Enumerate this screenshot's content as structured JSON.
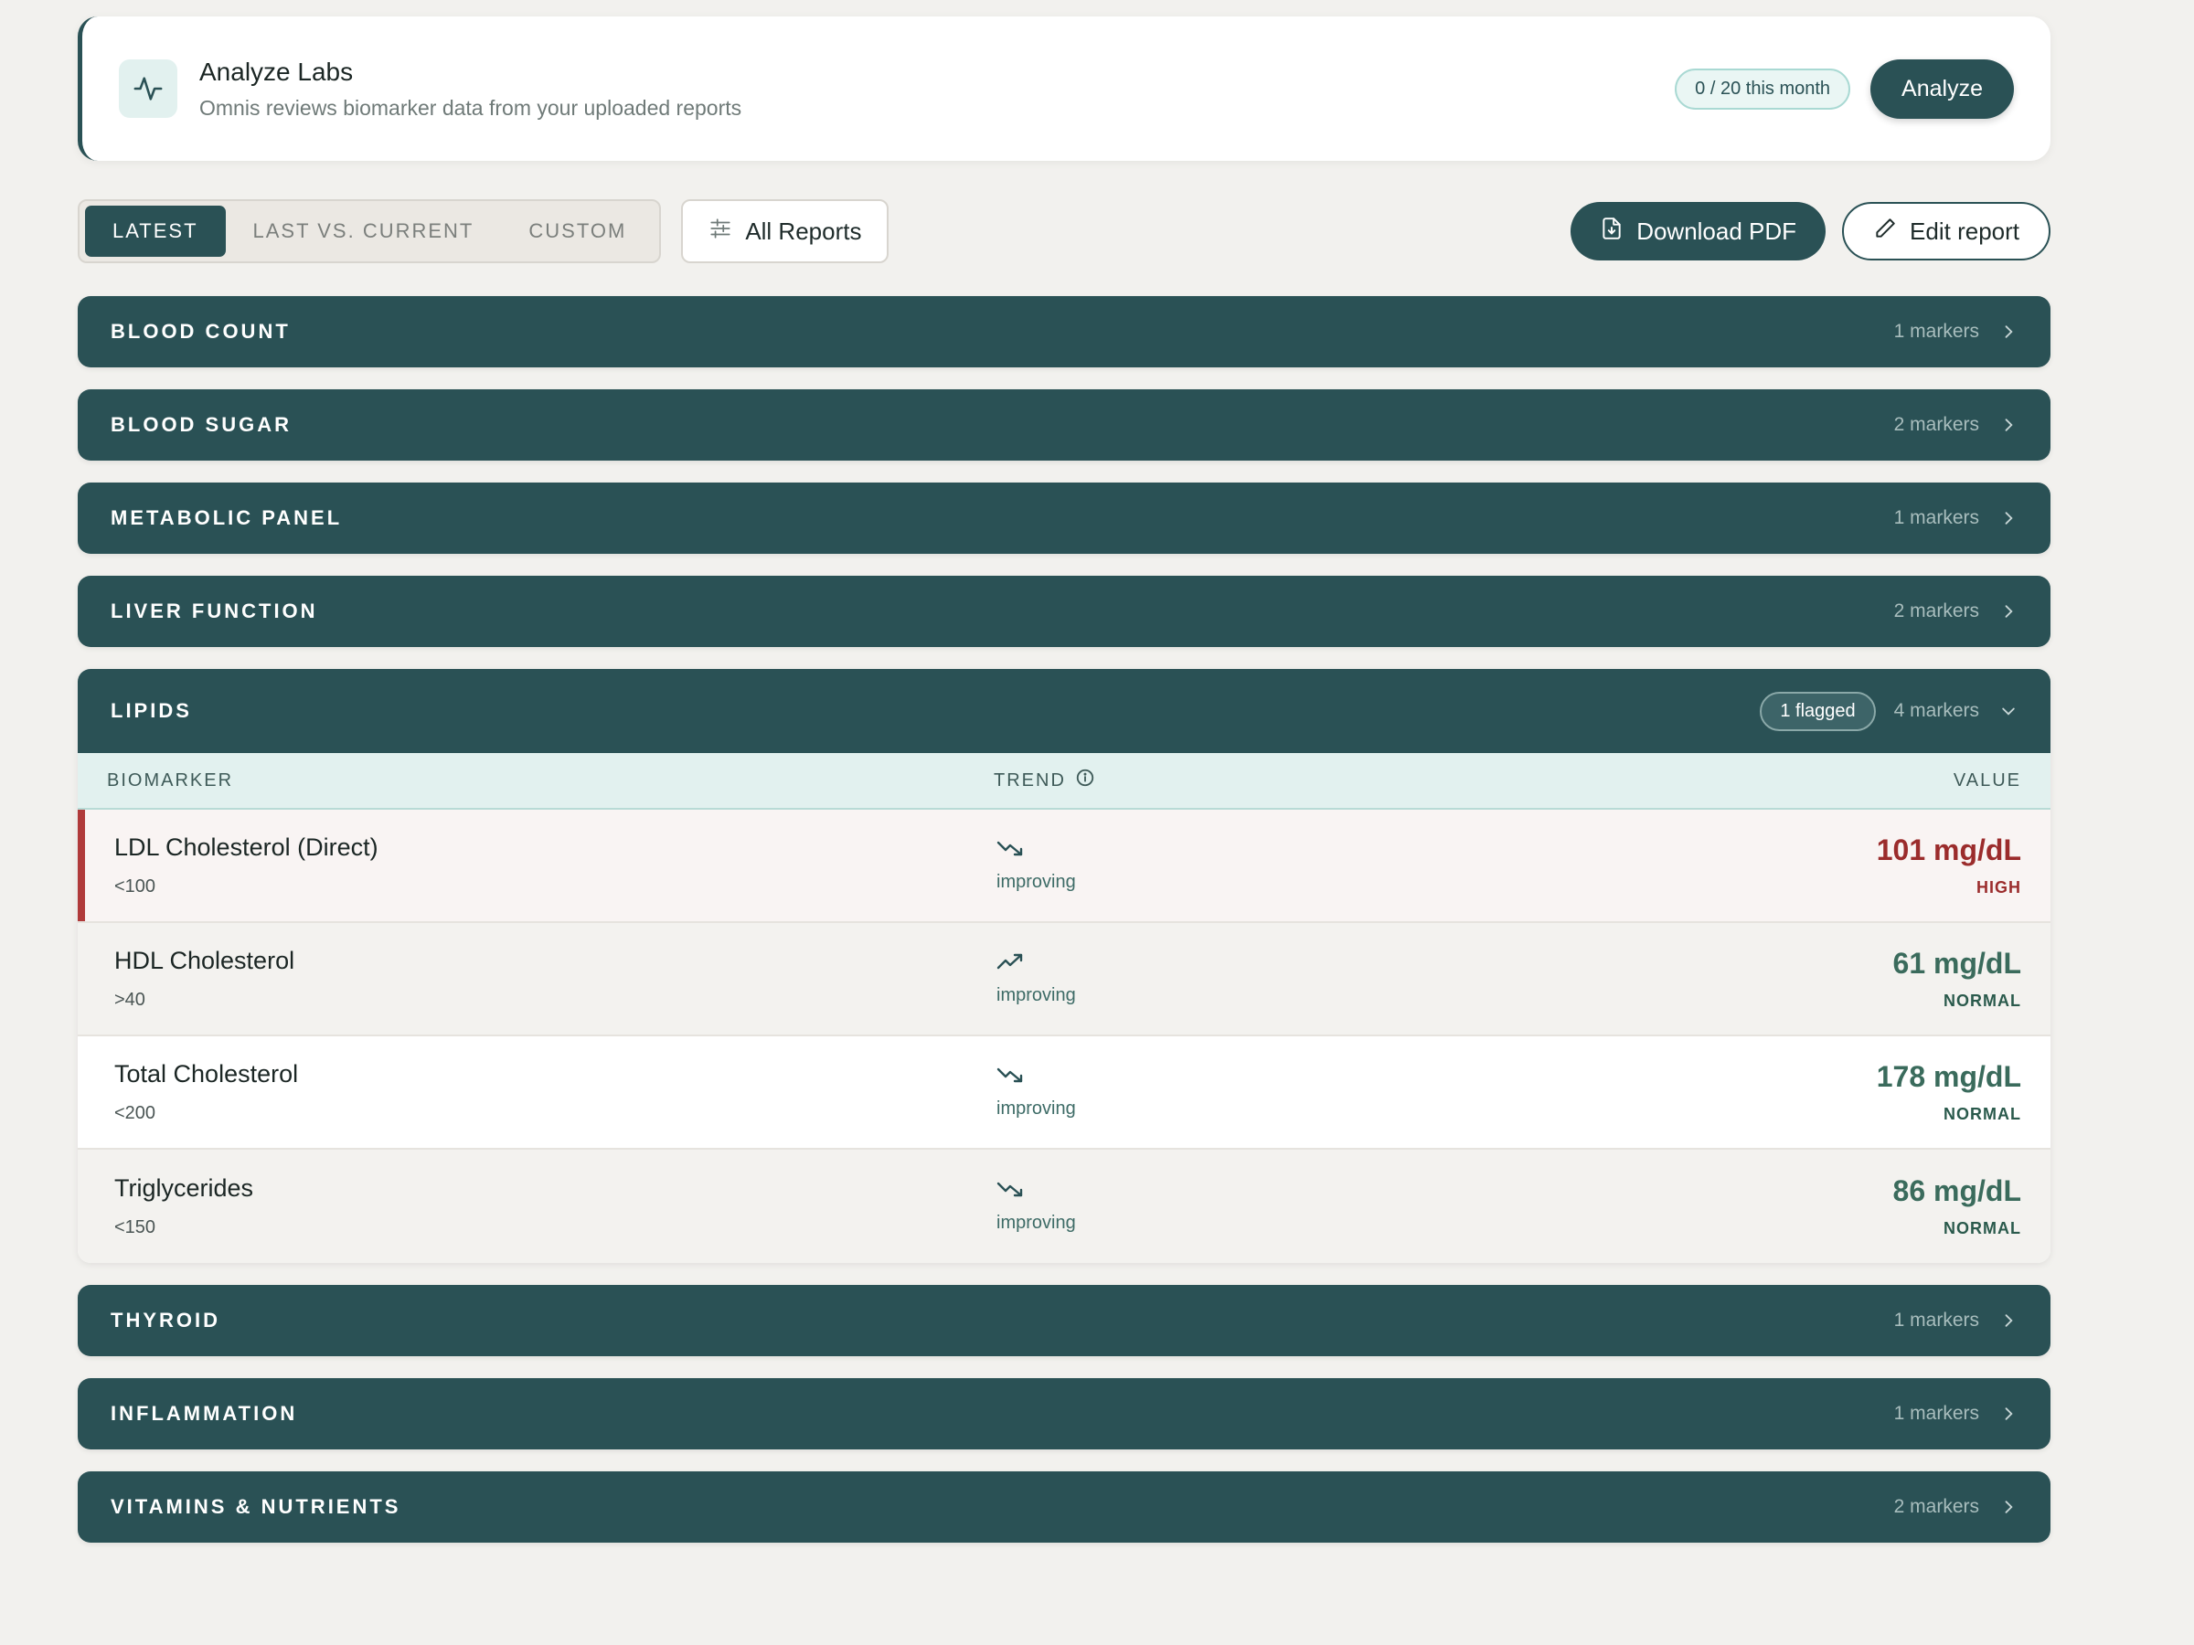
{
  "analyze": {
    "title": "Analyze Labs",
    "subtitle": "Omnis reviews biomarker data from your uploaded reports",
    "usage": "0 / 20 this month",
    "button": "Analyze",
    "icon": "activity-icon"
  },
  "toolbar": {
    "tabs": [
      "LATEST",
      "LAST VS. CURRENT",
      "CUSTOM"
    ],
    "active_tab": "LATEST",
    "all_reports": "All Reports",
    "download_pdf": "Download PDF",
    "edit_report": "Edit report"
  },
  "sections_before": [
    {
      "title": "BLOOD COUNT",
      "count": "1 markers"
    },
    {
      "title": "BLOOD SUGAR",
      "count": "2 markers"
    },
    {
      "title": "METABOLIC PANEL",
      "count": "1 markers"
    },
    {
      "title": "LIVER FUNCTION",
      "count": "2 markers"
    }
  ],
  "lipids": {
    "title": "LIPIDS",
    "flagged": "1 flagged",
    "count": "4 markers",
    "columns": {
      "biomarker": "BIOMARKER",
      "trend": "TREND",
      "value": "VALUE"
    },
    "rows": [
      {
        "name": "LDL Cholesterol (Direct)",
        "range": "<100",
        "trend": "improving",
        "trend_dir": "down",
        "value": "101 mg/dL",
        "status": "HIGH"
      },
      {
        "name": "HDL Cholesterol",
        "range": ">40",
        "trend": "improving",
        "trend_dir": "up",
        "value": "61 mg/dL",
        "status": "NORMAL"
      },
      {
        "name": "Total Cholesterol",
        "range": "<200",
        "trend": "improving",
        "trend_dir": "down",
        "value": "178 mg/dL",
        "status": "NORMAL"
      },
      {
        "name": "Triglycerides",
        "range": "<150",
        "trend": "improving",
        "trend_dir": "down",
        "value": "86 mg/dL",
        "status": "NORMAL"
      }
    ]
  },
  "sections_after": [
    {
      "title": "THYROID",
      "count": "1 markers"
    },
    {
      "title": "INFLAMMATION",
      "count": "1 markers"
    },
    {
      "title": "VITAMINS & NUTRIENTS",
      "count": "2 markers"
    }
  ],
  "colors": {
    "primary": "#2a5155",
    "flag": "#b03a3a",
    "normal": "#3a6b5c",
    "accent_bg": "#e2f1ef"
  }
}
